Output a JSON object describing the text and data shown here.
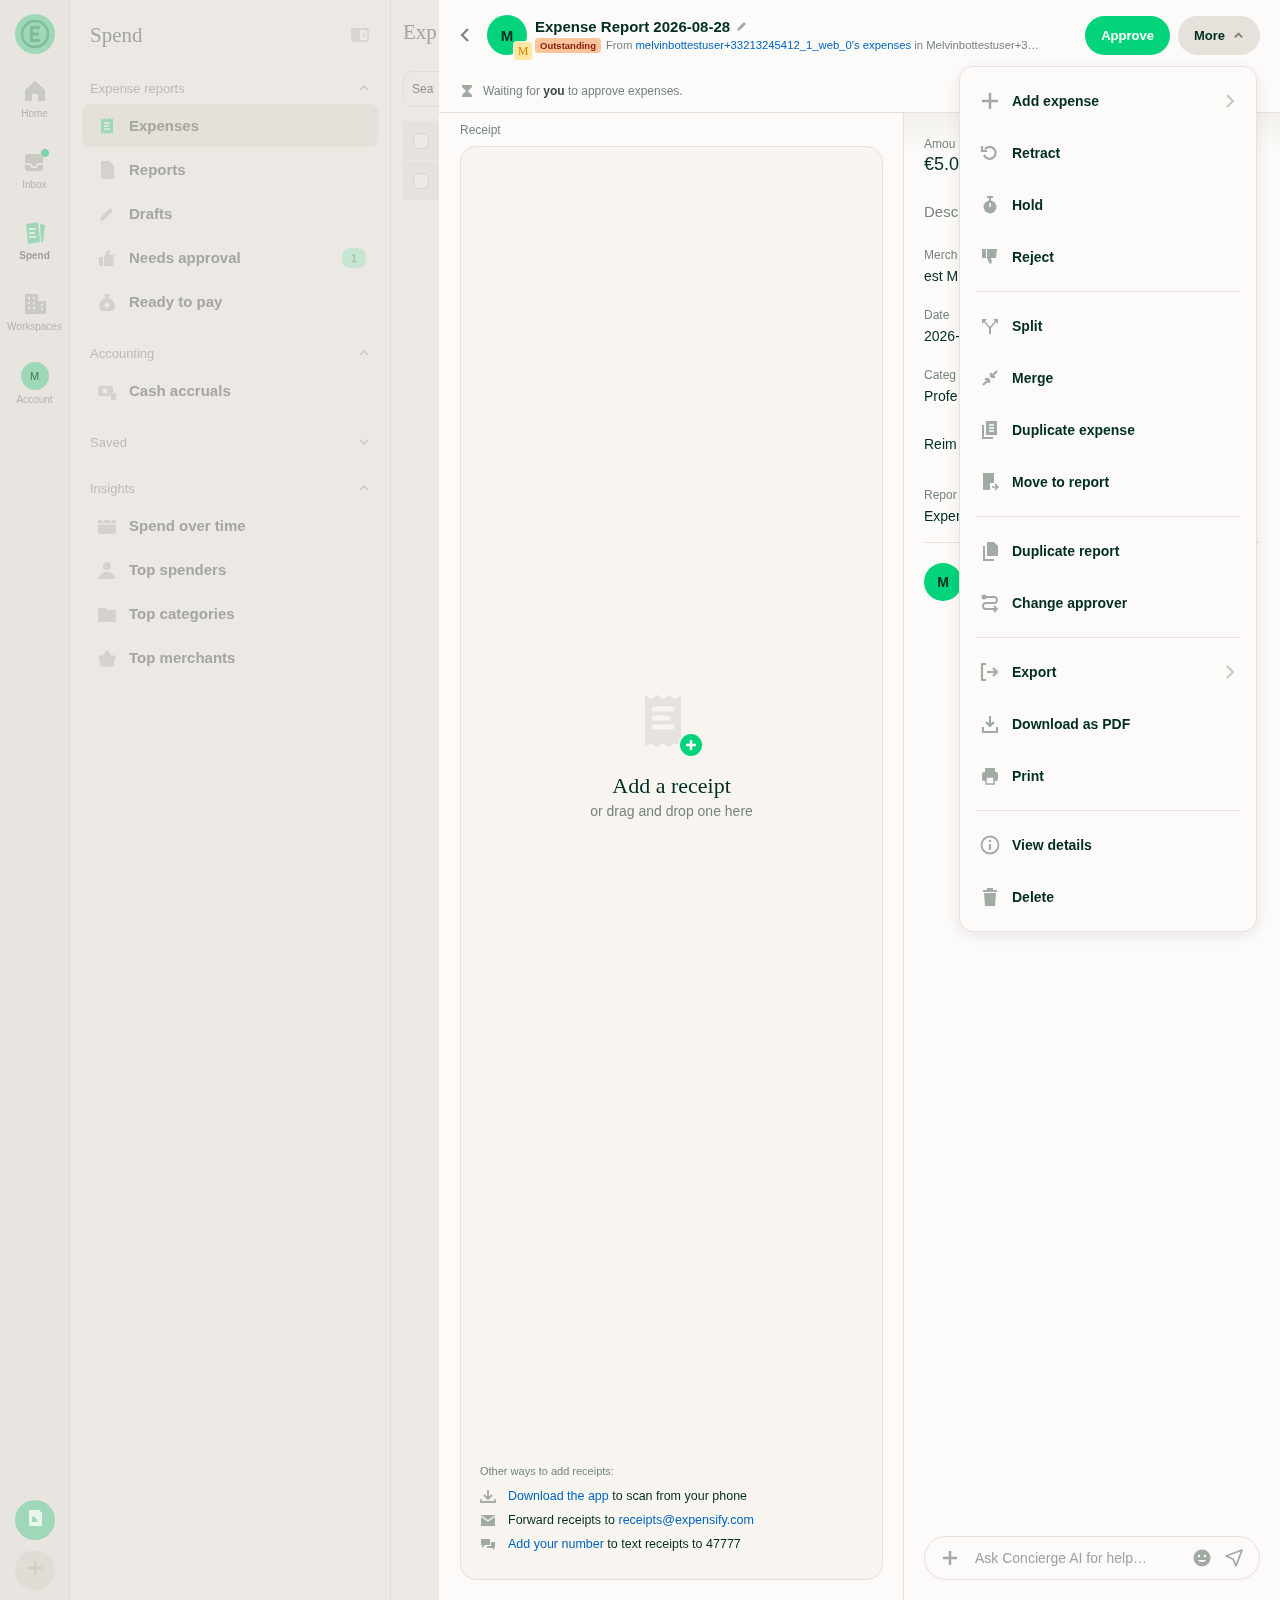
{
  "nav_rail": {
    "items": [
      {
        "label": "Home",
        "kind": "icon",
        "selected": false,
        "unread": false
      },
      {
        "label": "Inbox",
        "kind": "icon",
        "selected": false,
        "unread": true
      },
      {
        "label": "Spend",
        "kind": "icon",
        "selected": true,
        "unread": false
      },
      {
        "label": "Workspaces",
        "kind": "icon",
        "selected": false,
        "unread": false
      },
      {
        "label": "Account",
        "kind": "avatar",
        "initial": "M",
        "selected": false,
        "unread": false
      }
    ]
  },
  "sidebar": {
    "title": "Spend",
    "sections": [
      {
        "title": "Expense reports",
        "expanded": true,
        "items": [
          {
            "label": "Expenses",
            "selected": true
          },
          {
            "label": "Reports",
            "selected": false
          },
          {
            "label": "Drafts",
            "selected": false
          },
          {
            "label": "Needs approval",
            "selected": false,
            "badge": "1"
          },
          {
            "label": "Ready to pay",
            "selected": false
          }
        ]
      },
      {
        "title": "Accounting",
        "expanded": true,
        "items": [
          {
            "label": "Cash accruals",
            "selected": false
          }
        ]
      },
      {
        "title": "Saved",
        "expanded": false
      },
      {
        "title": "Insights",
        "expanded": true,
        "items": [
          {
            "label": "Spend over time",
            "selected": false
          },
          {
            "label": "Top spenders",
            "selected": false
          },
          {
            "label": "Top categories",
            "selected": false
          },
          {
            "label": "Top merchants",
            "selected": false
          }
        ]
      }
    ]
  },
  "list_pane": {
    "title": "Exp",
    "search": {
      "placeholder": "Sea"
    },
    "rows": [
      {
        "checked": false
      },
      {
        "checked": false
      }
    ]
  },
  "report_header": {
    "avatar": "M",
    "workspace_avatar": "M",
    "title": "Expense Report 2026-08-28",
    "status": "Outstanding",
    "from_prefix": "From ",
    "from_link": "melvinbottestuser+33213245412_1_web_0's expenses",
    "from_suffix": " in Melvinbottestuser+3…",
    "buttons": [
      {
        "label": "Approve",
        "kind": "primary"
      },
      {
        "label": "More",
        "kind": "menu",
        "expanded": true
      }
    ]
  },
  "next_step": "Waiting for **you** to approve expenses.",
  "receipt": {
    "label": "Receipt",
    "title": "Add a receipt",
    "subtitle": "or drag and drop one here",
    "other_ways_title": "Other ways to add receipts:",
    "other_ways": [
      {
        "parts": [
          {
            "text": "Download the app",
            "link": true
          },
          {
            "text": " to scan from your phone",
            "link": false
          }
        ]
      },
      {
        "parts": [
          {
            "text": "Forward receipts to ",
            "link": false
          },
          {
            "text": "receipts@expensify.com",
            "link": true
          }
        ]
      },
      {
        "parts": [
          {
            "text": "Add your number",
            "link": true
          },
          {
            "text": " to text receipts to 47777",
            "link": false
          }
        ]
      }
    ]
  },
  "details": {
    "fields": [
      {
        "kind": "amount",
        "label": "Amou",
        "value": "€5.0"
      },
      {
        "kind": "empty",
        "label": "Desc"
      },
      {
        "kind": "field",
        "label": "Merch",
        "value": "est M"
      },
      {
        "kind": "field",
        "label": "Date",
        "value": "2026-"
      },
      {
        "kind": "field",
        "label": "Categ",
        "value": "Profe"
      },
      {
        "kind": "row",
        "label": "Reim"
      },
      {
        "kind": "field",
        "label": "Repor",
        "value": "Exper"
      }
    ],
    "avatar": "M"
  },
  "chat": {
    "placeholder": "Ask Concierge AI for help…"
  },
  "more_menu": {
    "groups": [
      [
        {
          "label": "Add expense",
          "submenu": true
        },
        {
          "label": "Retract",
          "submenu": false
        },
        {
          "label": "Hold",
          "submenu": false
        },
        {
          "label": "Reject",
          "submenu": false
        }
      ],
      [
        {
          "label": "Split",
          "submenu": false
        },
        {
          "label": "Merge",
          "submenu": false
        },
        {
          "label": "Duplicate expense",
          "submenu": false
        },
        {
          "label": "Move to report",
          "submenu": false
        }
      ],
      [
        {
          "label": "Duplicate report",
          "submenu": false
        },
        {
          "label": "Change approver",
          "submenu": false
        }
      ],
      [
        {
          "label": "Export",
          "submenu": true
        },
        {
          "label": "Download as PDF",
          "submenu": false
        },
        {
          "label": "Print",
          "submenu": false
        }
      ],
      [
        {
          "label": "View details",
          "submenu": false
        },
        {
          "label": "Delete",
          "submenu": false
        }
      ]
    ]
  }
}
